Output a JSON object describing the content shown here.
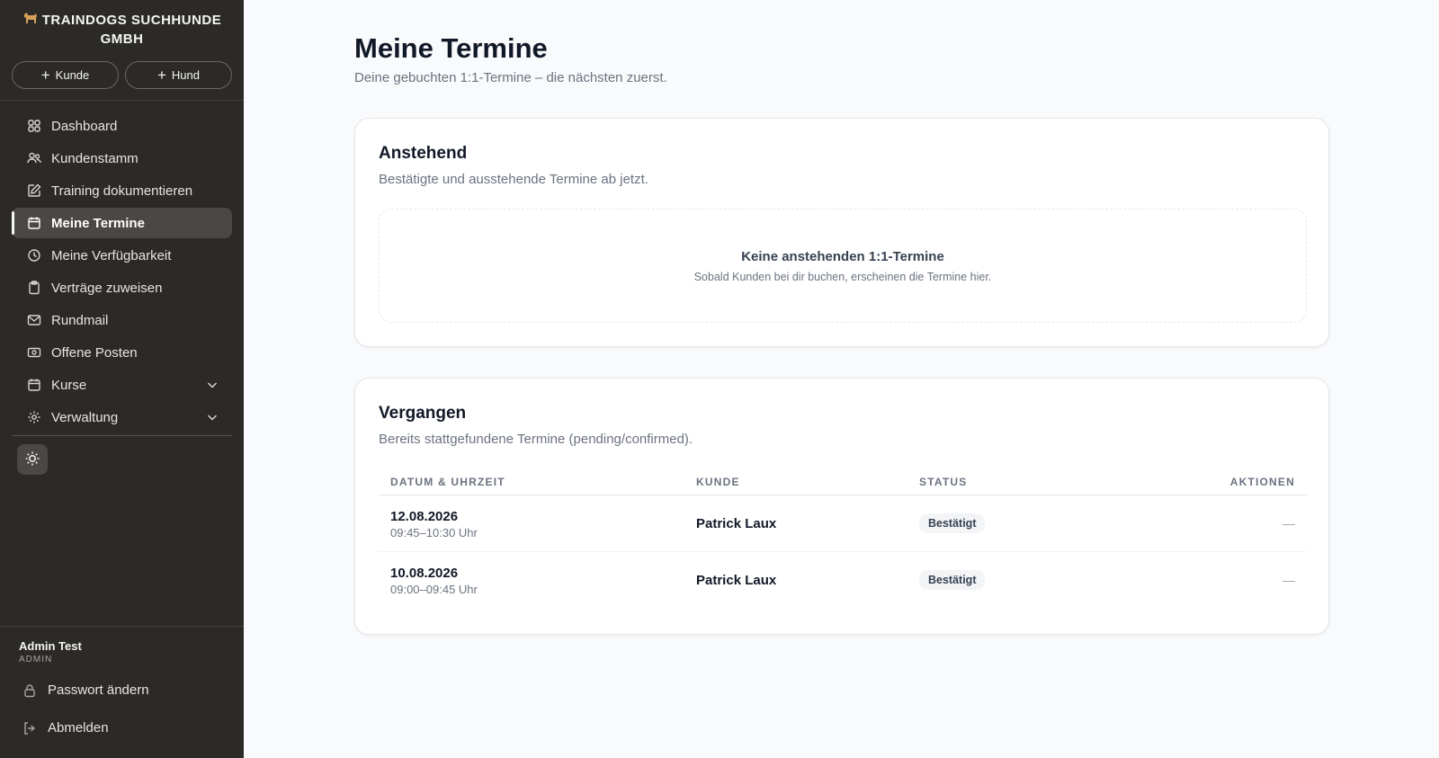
{
  "sidebar": {
    "brand": "TRAINDOGS SUCHHUNDE GMBH",
    "quick_actions": [
      {
        "label": "Kunde",
        "icon": "plus-icon"
      },
      {
        "label": "Hund",
        "icon": "plus-icon"
      }
    ],
    "items": [
      {
        "label": "Dashboard",
        "icon": "grid-icon"
      },
      {
        "label": "Kundenstamm",
        "icon": "users-icon"
      },
      {
        "label": "Training dokumentieren",
        "icon": "edit-icon"
      },
      {
        "label": "Meine Termine",
        "icon": "calendar-icon",
        "active": true
      },
      {
        "label": "Meine Verfügbarkeit",
        "icon": "clock-icon"
      },
      {
        "label": "Verträge zuweisen",
        "icon": "clipboard-icon"
      },
      {
        "label": "Rundmail",
        "icon": "mail-icon"
      },
      {
        "label": "Offene Posten",
        "icon": "money-icon"
      },
      {
        "label": "Kurse",
        "icon": "calendar-icon",
        "expandable": true
      },
      {
        "label": "Verwaltung",
        "icon": "gear-icon",
        "expandable": true
      }
    ],
    "theme_toggle_icon": "sun-icon",
    "user": {
      "name": "Admin Test",
      "role": "ADMIN"
    },
    "footer": [
      {
        "label": "Passwort ändern",
        "icon": "lock-icon"
      },
      {
        "label": "Abmelden",
        "icon": "logout-icon"
      }
    ]
  },
  "main": {
    "title": "Meine Termine",
    "subtitle": "Deine gebuchten 1:1-Termine – die nächsten zuerst.",
    "upcoming": {
      "title": "Anstehend",
      "subtitle": "Bestätigte und ausstehende Termine ab jetzt.",
      "empty_title": "Keine anstehenden 1:1-Termine",
      "empty_sub": "Sobald Kunden bei dir buchen, erscheinen die Termine hier."
    },
    "past": {
      "title": "Vergangen",
      "subtitle": "Bereits stattgefundene Termine (pending/confirmed).",
      "columns": [
        "DATUM & UHRZEIT",
        "KUNDE",
        "STATUS",
        "AKTIONEN"
      ],
      "rows": [
        {
          "date": "12.08.2026",
          "time": "09:45–10:30 Uhr",
          "customer": "Patrick Laux",
          "status": "Bestätigt",
          "action": "—"
        },
        {
          "date": "10.08.2026",
          "time": "09:00–09:45 Uhr",
          "customer": "Patrick Laux",
          "status": "Bestätigt",
          "action": "—"
        }
      ]
    }
  }
}
